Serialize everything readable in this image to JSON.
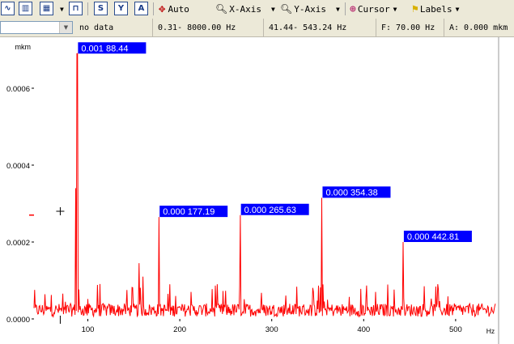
{
  "toolbar": {
    "auto_label": "Auto",
    "xaxis_label": "X-Axis",
    "yaxis_label": "Y-Axis",
    "cursor_label": "Cursor",
    "labels_label": "Labels",
    "icons": [
      "waveform-icon",
      "bar-chart-icon",
      "grid-chart-icon",
      "dropdown-icon",
      "spectrum-icon",
      "s-tool-icon",
      "y-tool-icon",
      "a-tool-icon",
      "move-icon",
      "zoom-x-icon",
      "zoom-y-icon",
      "target-icon",
      "flag-icon"
    ]
  },
  "status": {
    "combo_value": "",
    "data_text": "no data",
    "freq_range": "0.31- 8000.00 Hz",
    "view_range": "41.44- 543.24 Hz",
    "cursor_freq": "F: 70.00 Hz",
    "cursor_amp": "A: 0.000 mkm"
  },
  "chart_data": {
    "type": "line",
    "ylabel": "mkm",
    "xlabel": "Hz",
    "xlim": [
      41.44,
      543.24
    ],
    "ylim": [
      0,
      0.00072
    ],
    "x_ticks": [
      100,
      200,
      300,
      400,
      500
    ],
    "y_ticks": [
      0.0,
      0.0002,
      0.0004,
      0.0006
    ],
    "y_tick_labels": [
      "0.0000",
      "0.0002",
      "0.0004",
      "0.0006"
    ],
    "x_tick_labels": [
      "100",
      "200",
      "300",
      "400",
      "500"
    ],
    "series_color": "#ff0000",
    "noise_floor": 4e-05,
    "cursor": {
      "x": 70,
      "y": 0.00028
    },
    "peaks": [
      {
        "freq": 88.44,
        "amp": 0.00069,
        "label_amp": "0.001",
        "label_freq": "88.44"
      },
      {
        "freq": 177.19,
        "amp": 0.000265,
        "label_amp": "0.000",
        "label_freq": "177.19"
      },
      {
        "freq": 265.63,
        "amp": 0.00027,
        "label_amp": "0.000",
        "label_freq": "265.63"
      },
      {
        "freq": 354.38,
        "amp": 0.000315,
        "label_amp": "0.000",
        "label_freq": "354.38"
      },
      {
        "freq": 442.81,
        "amp": 0.0002,
        "label_amp": "0.000",
        "label_freq": "442.81"
      }
    ],
    "secondary_peaks": [
      {
        "freq": 86.5,
        "amp": 0.00034
      },
      {
        "freq": 156.0,
        "amp": 0.000145
      },
      {
        "freq": 160.0,
        "amp": 0.00011
      }
    ],
    "label_bg": "#0000ff",
    "label_color": "#ffffff"
  }
}
